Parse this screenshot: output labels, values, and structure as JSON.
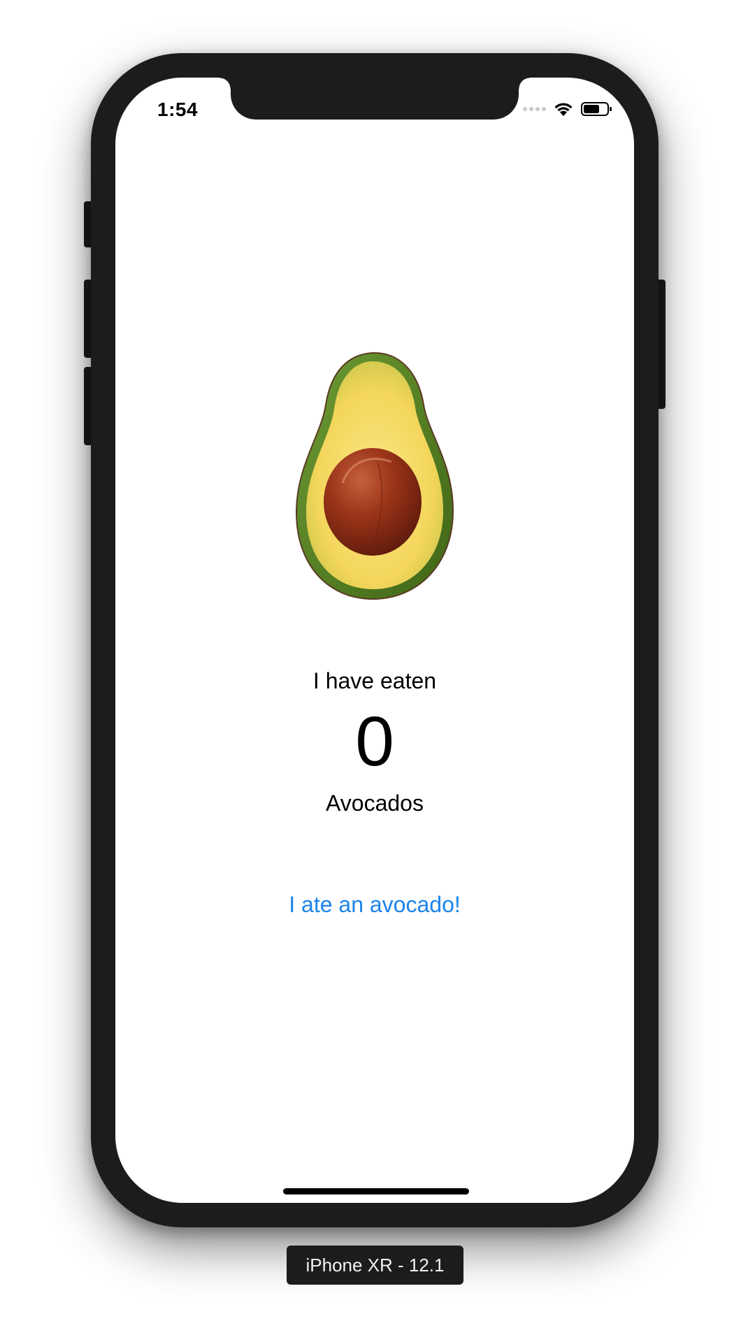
{
  "status_bar": {
    "time": "1:54"
  },
  "content": {
    "heading": "I have eaten",
    "count": "0",
    "unit": "Avocados",
    "action_label": "I ate an avocado!"
  },
  "device_label": "iPhone XR - 12.1",
  "colors": {
    "accent": "#1a83ea",
    "device_body": "#1c1c1c",
    "avocado_skin": "#4f7a20",
    "avocado_flesh": "#f2d65e",
    "avocado_pit": "#8a2a14"
  },
  "icons": {
    "signal": "signal-icon",
    "wifi": "wifi-icon",
    "battery": "battery-icon",
    "avocado": "avocado-image"
  }
}
